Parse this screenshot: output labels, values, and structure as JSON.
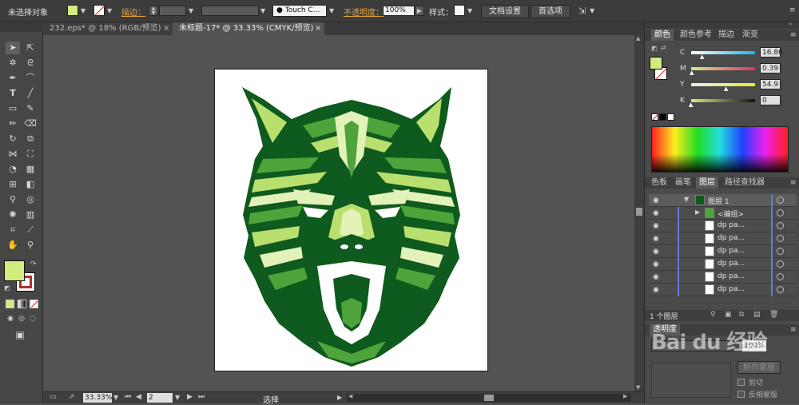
{
  "control_bar": {
    "selection_status": "未选择对象",
    "stroke_label": "描边：",
    "brush_definition": "Touch C...",
    "opacity_label": "不透明度：",
    "opacity_value": "100%",
    "style_label": "样式：",
    "doc_setup_button": "文档设置",
    "preferences_button": "首选项"
  },
  "tabs": [
    {
      "label": "232.eps* @ 18% (RGB/预览)"
    },
    {
      "label": "未标题-17* @ 33.33% (CMYK/预览)"
    }
  ],
  "color_panel": {
    "tabs": [
      "颜色",
      "颜色参考",
      "描边",
      "渐变"
    ],
    "channels": [
      {
        "label": "C",
        "value": "16.86"
      },
      {
        "label": "M",
        "value": "0.39"
      },
      {
        "label": "Y",
        "value": "54.9"
      },
      {
        "label": "K",
        "value": "0"
      }
    ]
  },
  "layers_panel": {
    "tabs": [
      "色板",
      "画笔",
      "图层",
      "路径查找器"
    ],
    "layer_name": "图层 1",
    "group_name": "<编组>",
    "items": [
      "dp pa...",
      "dp pa...",
      "dp pa...",
      "dp pa...",
      "dp pa...",
      "dp pa..."
    ],
    "layer_count": "1 个图层"
  },
  "transparency_panel": {
    "title": "透明度",
    "opacity_value": "100%",
    "make_mask_button": "制作蒙版",
    "clip_label": "剪切",
    "invert_mask_label": "反相蒙版"
  },
  "status_bar": {
    "zoom": "33.33%",
    "page": "2",
    "tool_status": "选择"
  },
  "colors": {
    "fill": "#d2ec80",
    "wolf_dark": "#0f5a1e",
    "wolf_mid": "#4ea43a",
    "wolf_light": "#b9df6e",
    "wolf_pale": "#e3f2b8"
  },
  "watermark": "Bai du 经验"
}
